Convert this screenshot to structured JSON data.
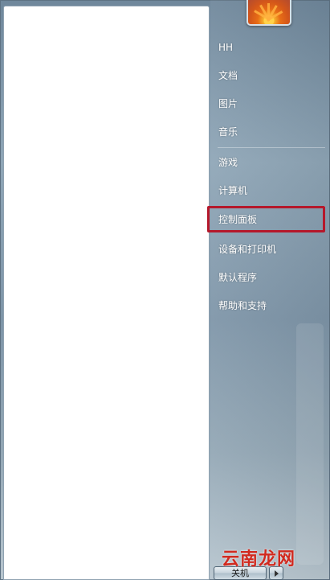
{
  "start_menu": {
    "user_name": "HH",
    "items": [
      {
        "label": "HH"
      },
      {
        "label": "文档"
      },
      {
        "label": "图片"
      },
      {
        "label": "音乐"
      },
      {
        "label": "游戏"
      },
      {
        "label": "计算机"
      },
      {
        "label": "控制面板",
        "highlighted": true
      },
      {
        "label": "设备和打印机"
      },
      {
        "label": "默认程序"
      },
      {
        "label": "帮助和支持"
      }
    ],
    "shutdown_label": "关机"
  },
  "watermark": "云南龙网",
  "colors": {
    "highlight_border": "#b5182b",
    "menu_text": "#ffffff"
  }
}
